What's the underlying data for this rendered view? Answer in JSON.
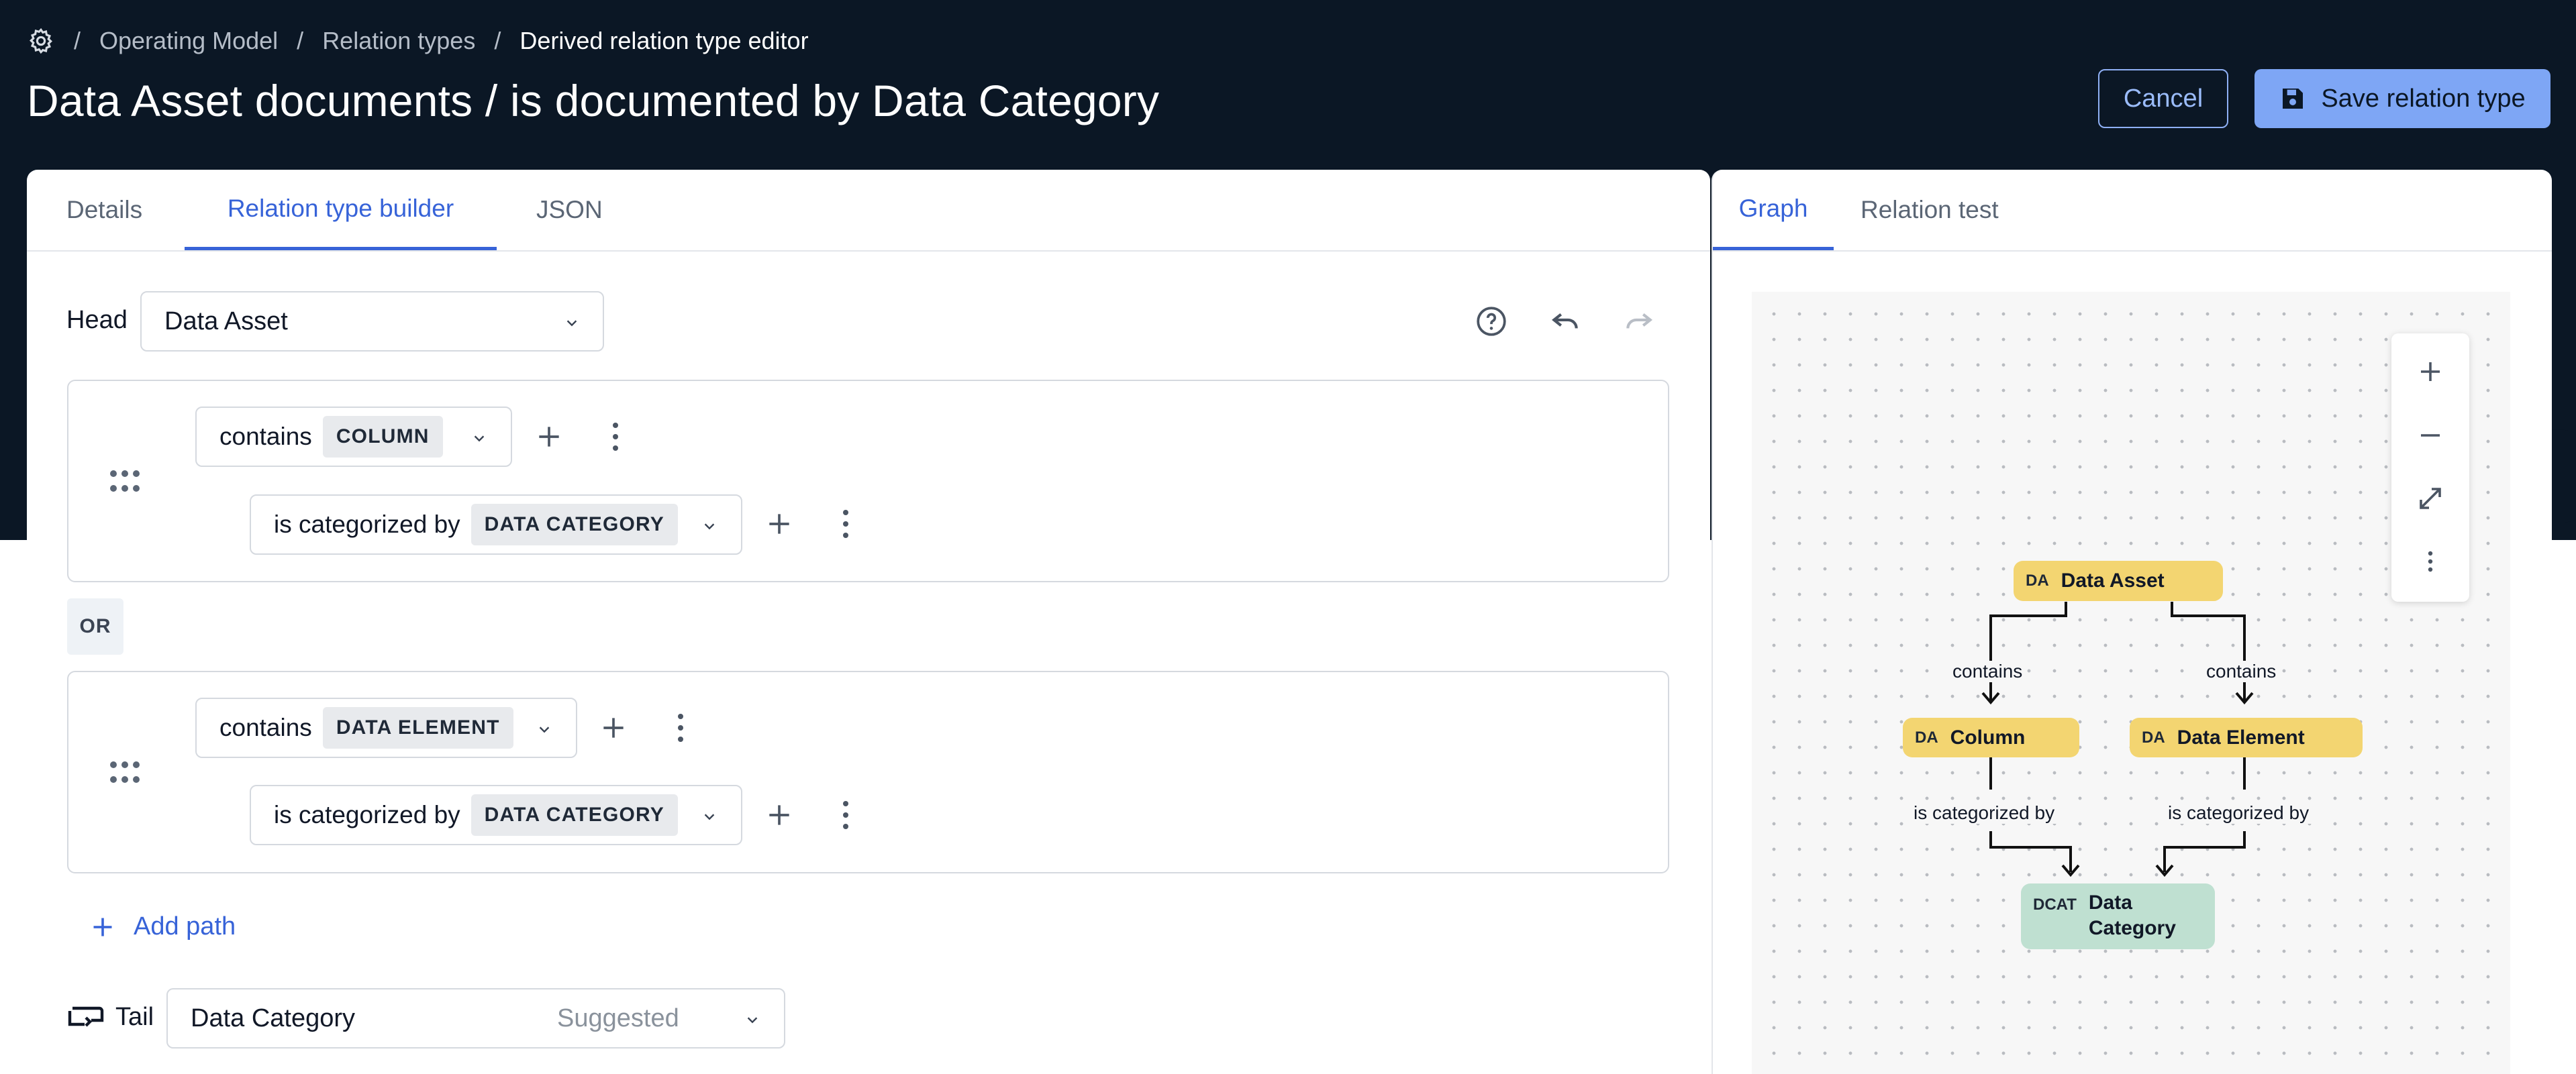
{
  "breadcrumb": {
    "settings_icon": "gear-icon",
    "items": [
      "Operating Model",
      "Relation types",
      "Derived relation type editor"
    ],
    "separator": "/"
  },
  "header": {
    "title": "Data Asset documents / is documented by Data Category",
    "cancel_label": "Cancel",
    "save_label": "Save relation type",
    "save_icon": "floppy-disk-icon"
  },
  "left_tabs": [
    {
      "label": "Details",
      "active": false
    },
    {
      "label": "Relation type builder",
      "active": true
    },
    {
      "label": "JSON",
      "active": false
    }
  ],
  "right_tabs": [
    {
      "label": "Graph",
      "active": true
    },
    {
      "label": "Relation test",
      "active": false
    }
  ],
  "builder": {
    "head_label": "Head",
    "head_value": "Data Asset",
    "toolbar_icons": [
      "help-circle-icon",
      "undo-icon",
      "redo-icon"
    ],
    "paths": [
      {
        "steps": [
          {
            "relation": "contains",
            "type": "COLUMN"
          },
          {
            "relation": "is categorized by",
            "type": "DATA CATEGORY"
          }
        ]
      },
      {
        "steps": [
          {
            "relation": "contains",
            "type": "DATA ELEMENT"
          },
          {
            "relation": "is categorized by",
            "type": "DATA CATEGORY"
          }
        ]
      }
    ],
    "or_label": "OR",
    "add_path_label": "Add path",
    "tail_label": "Tail",
    "tail_value": "Data Category",
    "tail_hint": "Suggested"
  },
  "graph": {
    "zoom_controls": [
      "zoom-in-icon",
      "zoom-out-icon",
      "fit-screen-icon",
      "more-vertical-icon"
    ],
    "nodes": [
      {
        "abbr": "DA",
        "label": "Data Asset",
        "color": "#f3d571"
      },
      {
        "abbr": "DA",
        "label": "Column",
        "color": "#f3d571"
      },
      {
        "abbr": "DA",
        "label": "Data Element",
        "color": "#f3d571"
      },
      {
        "abbr": "DCAT",
        "label": "Data Category",
        "color": "#bfe0d1"
      }
    ],
    "edge_labels": [
      "contains",
      "contains",
      "is categorized by",
      "is categorized by"
    ]
  },
  "colors": {
    "header_bg": "#0b1725",
    "accent": "#3763d8",
    "save_button": "#7ea6f5",
    "node_yellow": "#f3d571",
    "node_green": "#bfe0d1"
  }
}
